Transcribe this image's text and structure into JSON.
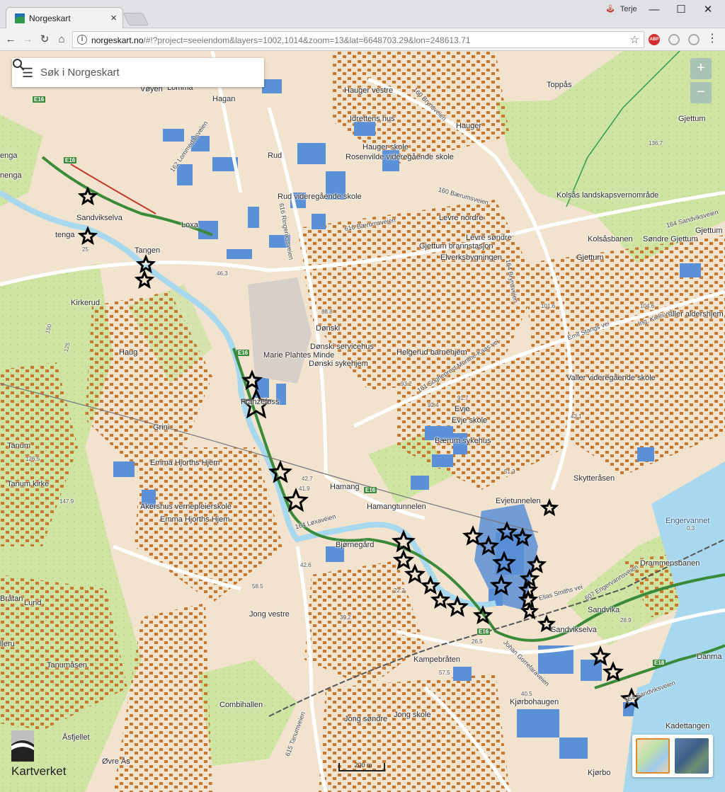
{
  "browser": {
    "tab_title": "Norgeskart",
    "profile_name": "Terje",
    "url_host": "norgeskart.no",
    "url_rest": "/#!?project=seeiendom&layers=1002,1014&zoom=13&lat=6648703.29&lon=248613.71",
    "extensions": [
      "ABP"
    ]
  },
  "map": {
    "search_placeholder": "Søk i Norgeskart",
    "zoom_in": "+",
    "zoom_out": "−",
    "logo_text": "Kartverket",
    "scale_label": "200 m",
    "colors": {
      "land": "#f2e3cf",
      "forest": "#cfe3a3",
      "water": "#a8d8ee",
      "building_res": "#c8772e",
      "building_public": "#5b8fd6",
      "road": "#ffffff",
      "highway": "#3a8a3a",
      "marker": "#000000"
    },
    "labels": {
      "voyen": "Vøyen",
      "lomma": "Lomma",
      "hagan": "Hagan",
      "hauger_vestre": "Hauger vestre",
      "toppas": "Toppås",
      "gjettum": "Gjettum",
      "idrettens_hus": "Idrettens hus",
      "hauger": "Hauger",
      "hauger_skole": "Hauger skole",
      "rosenvilde": "Rosenvilde videregående skole",
      "rud": "Rud",
      "rud_vgs": "Rud videregående skole",
      "sandvikselva": "Sandvikselva",
      "tenga": "tenga",
      "tengen": "enga",
      "loxa": "Loxa",
      "tangen": "Tangen",
      "levre_nordre": "Levre nordre",
      "levre_sondre": "Levre søndre",
      "gjettum_brann": "Gjettum brannstasjon",
      "elverks": "Elverksbygningen",
      "kolsas_lv": "Kolsås landskapsvernområde",
      "kolsasbanen": "Kolsåsbanen",
      "gjettum2": "Gjettum",
      "sondre_gjettum": "Søndre Gjettum",
      "gjettum3": "Gjettum",
      "kirkerud": "Kirkerud",
      "donski": "Dønski",
      "haug": "Haug",
      "marie_plahtes": "Marie Plahtes Minde",
      "donski_service": "Dønski servicehus",
      "helgerud": "Helgerud barnehjem",
      "donski_syke": "Dønski sykehjem",
      "aller": "aller aldershjem",
      "valler": "Valler videregående skole",
      "franzefoss": "Franzefoss",
      "grini": "Grini",
      "evje": "Evje",
      "evje_skole": "Evje skole",
      "tanum": "Tanum",
      "baerum_sykehus": "Bærum sykehus",
      "emma1": "Emma Hjorths Hjem",
      "tanum_kirke": "Tanum kirke",
      "hamang": "Hamang",
      "skytteraasen": "Skytteråsen",
      "akershus_vp": "Akershus vernepleierskole",
      "hamangtunnelen": "Hamangtunnelen",
      "emma2": "Emma Hjorths Hjem",
      "evjetunnelen": "Evjetunnelen",
      "engervannet": "Engervannet",
      "bjornegard": "Bjørnegård",
      "drammensbanen": "Drammensbanen",
      "bratan": "Bråtan",
      "lund": "Lund",
      "jong_vestre": "Jong vestre",
      "sandvika": "Sandvika",
      "sandvikselva2": "Sandvikselva",
      "kampebraten": "Kampebråten",
      "danmark": "Danma",
      "tanumasen": "Tanumåsen",
      "combihallen": "Combihallen",
      "kjorbohaugen": "Kjørbohaugen",
      "jong_sondre": "Jong søndre",
      "jong_skole": "Jong skole",
      "asfjellet": "Åsfjellet",
      "kadettangen": "Kadettangen",
      "ovre_as": "Øvre Ås",
      "kjorbo": "Kjørbo",
      "lleru": "lleru",
      "nenga": "nenga"
    },
    "route_shields": [
      "E16",
      "E16",
      "E16",
      "E16",
      "E16",
      "E18"
    ],
    "road_labels": [
      "160 Brynsveien",
      "160 Bærumsveien",
      "616 Bærumsveien",
      "616 Ringerikssveien",
      "162 Lommedalsveien",
      "161 Sogneprest Munthe-Kaas vei",
      "164 Brynsveien",
      "607 Engervannsveien",
      "615 Tanumveien",
      "164 Løxaveien",
      "Emil Stangs vei",
      "Ing. Kiellsvei",
      "164 Sandviksveien",
      "164 Sandviksveien",
      "Elias Smiths vei",
      "Johan Gorrefaraveien"
    ],
    "elevations": [
      "46.3",
      "88.8",
      "92.4",
      "93.2",
      "91.7",
      "42.7",
      "41.9",
      "42.6",
      "58.5",
      "22.2",
      "39.2",
      "26.5",
      "40.5",
      "51.3",
      "57.5",
      "104.6",
      "101.6",
      "136.7",
      "28.9",
      "0.3",
      "125",
      "150",
      "25",
      "126.5",
      "147.9",
      "42.1"
    ],
    "markers_count": 33
  }
}
